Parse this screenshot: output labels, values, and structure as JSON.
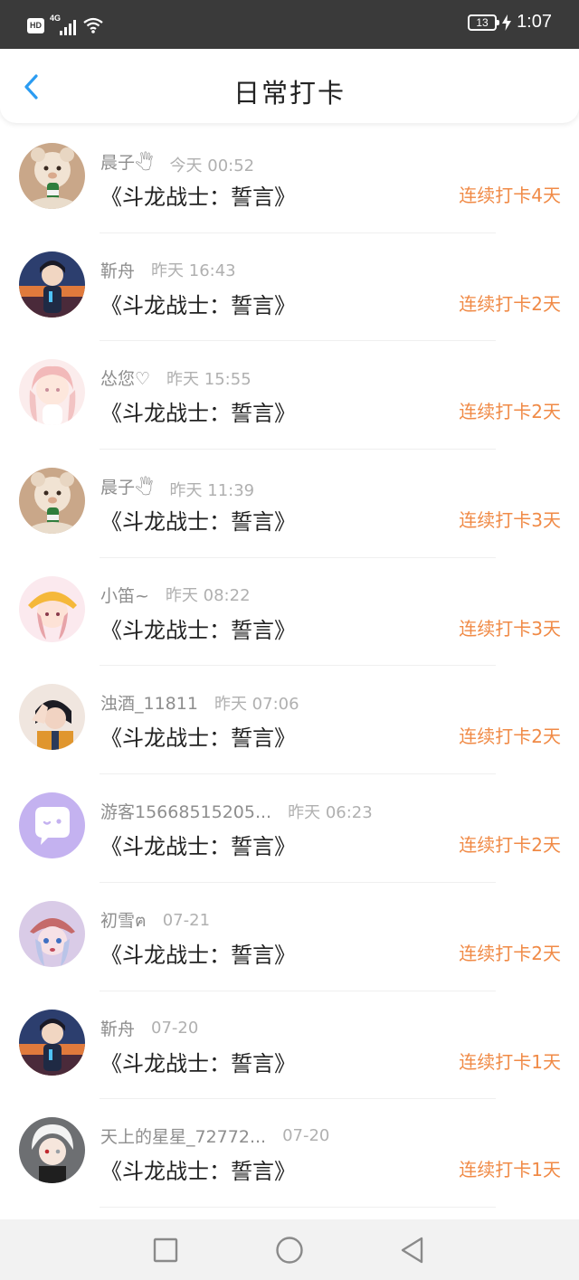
{
  "status_bar": {
    "hd": "HD",
    "network": "4G",
    "battery": "13",
    "time": "1:07"
  },
  "header": {
    "title": "日常打卡",
    "back_icon": "chevron-left-icon",
    "accent": "#2b9cf2"
  },
  "checkins": [
    {
      "name": "晨子🖑",
      "time": "今天 00:52",
      "title": "《斗龙战士：誓言》",
      "streak": "连续打卡4天",
      "avatar": "plush-bear"
    },
    {
      "name": "靳舟",
      "time": "昨天 16:43",
      "title": "《斗龙战士：誓言》",
      "streak": "连续打卡2天",
      "avatar": "anime-boy-sunset"
    },
    {
      "name": "怂您♡",
      "time": "昨天 15:55",
      "title": "《斗龙战士：誓言》",
      "streak": "连续打卡2天",
      "avatar": "pastel-girl"
    },
    {
      "name": "晨子🖑",
      "time": "昨天 11:39",
      "title": "《斗龙战士：誓言》",
      "streak": "连续打卡3天",
      "avatar": "plush-bear"
    },
    {
      "name": "小笛~",
      "time": "昨天 08:22",
      "title": "《斗龙战士：誓言》",
      "streak": "连续打卡3天",
      "avatar": "anime-girl-yellow-hat"
    },
    {
      "name": "浊酒_11811",
      "time": "昨天 07:06",
      "title": "《斗龙战士：誓言》",
      "streak": "连续打卡2天",
      "avatar": "anime-boy-hand"
    },
    {
      "name": "游客15668515205...",
      "time": "昨天 06:23",
      "title": "《斗龙战士：誓言》",
      "streak": "连续打卡2天",
      "avatar": "default-chat-bubble"
    },
    {
      "name": "初雪ฅ",
      "time": "07-21",
      "title": "《斗龙战士：誓言》",
      "streak": "连续打卡2天",
      "avatar": "anime-girl-cap"
    },
    {
      "name": "靳舟",
      "time": "07-20",
      "title": "《斗龙战士：誓言》",
      "streak": "连续打卡1天",
      "avatar": "anime-boy-sunset"
    },
    {
      "name": "天上的星星_72772...",
      "time": "07-20",
      "title": "《斗龙战士：誓言》",
      "streak": "连续打卡1天",
      "avatar": "white-hair-boy"
    }
  ],
  "colors": {
    "streak": "#f08a46",
    "status_bar": "#3a3a3a"
  },
  "nav_bar": {
    "buttons": [
      "recent-apps-icon",
      "home-icon",
      "back-icon"
    ]
  }
}
